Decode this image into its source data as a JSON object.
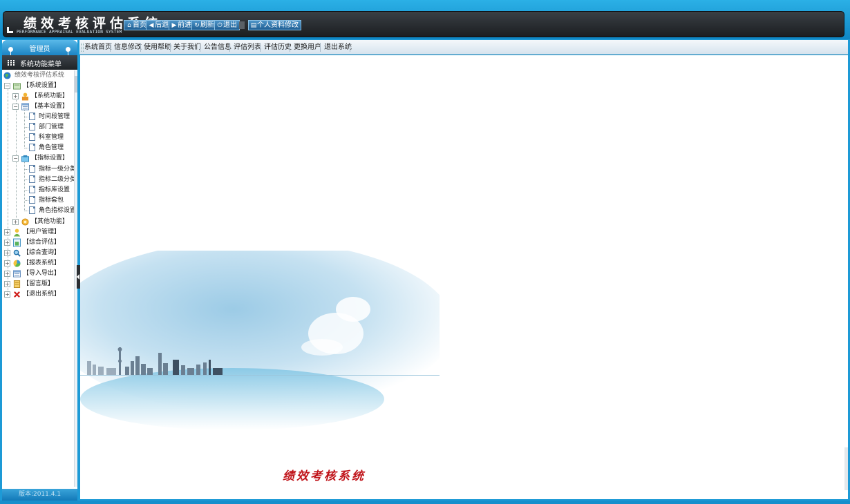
{
  "app": {
    "title": "绩效考核评估系统",
    "subtitle": "PERFORMANCE APPRAISAL EVALUATION SYSTEM"
  },
  "toolbar": {
    "buttons": [
      {
        "label": "首页",
        "icon": "home-icon"
      },
      {
        "label": "后退",
        "icon": "back-arrow-icon"
      },
      {
        "label": "前进",
        "icon": "forward-arrow-icon"
      },
      {
        "label": "刷新",
        "icon": "refresh-icon"
      },
      {
        "label": "退出",
        "icon": "power-icon"
      }
    ],
    "profile_button": {
      "label": "个人资料修改",
      "icon": "profile-card-icon"
    }
  },
  "topnav": {
    "items": [
      "系统首页",
      "信息修改",
      "使用帮助",
      "关于我们",
      "公告信息",
      "评估列表",
      "评估历史",
      "更换用户",
      "退出系统"
    ]
  },
  "sidebar": {
    "role_tab": "管理员",
    "menu_title": "系统功能菜单",
    "root": "绩效考核评估系统",
    "tree": [
      {
        "label": "【系统设置】",
        "icon": "settings-folder-icon",
        "expanded": true,
        "children": [
          {
            "label": "【系统功能】",
            "icon": "user-function-icon",
            "expanded": false
          },
          {
            "label": "【基本设置】",
            "icon": "basic-settings-icon",
            "expanded": true,
            "children": [
              "时间段管理",
              "部门管理",
              "科室管理",
              "角色管理"
            ]
          },
          {
            "label": "【指标设置】",
            "icon": "indicator-settings-icon",
            "expanded": true,
            "children": [
              "指标一级分类",
              "指标二级分类",
              "指标库设置",
              "指标套包",
              "角色指标设置"
            ]
          },
          {
            "label": "【其他功能】",
            "icon": "other-functions-icon",
            "expanded": false
          }
        ]
      },
      {
        "label": "【用户管理】",
        "icon": "user-icon"
      },
      {
        "label": "【综合评估】",
        "icon": "evaluation-icon"
      },
      {
        "label": "【综合查询】",
        "icon": "search-icon"
      },
      {
        "label": "【报表系统】",
        "icon": "report-chart-icon"
      },
      {
        "label": "【导入导出】",
        "icon": "import-export-icon"
      },
      {
        "label": "【留言版】",
        "icon": "message-board-icon"
      },
      {
        "label": "【退出系统】",
        "icon": "exit-x-icon"
      }
    ],
    "version": "版本:2011.4.1"
  },
  "main": {
    "welcome_title": "绩效考核系统"
  },
  "colors": {
    "frame_blue": "#1d9ad6",
    "header_dark": "#2b2f33",
    "title_red": "#c0141a"
  }
}
